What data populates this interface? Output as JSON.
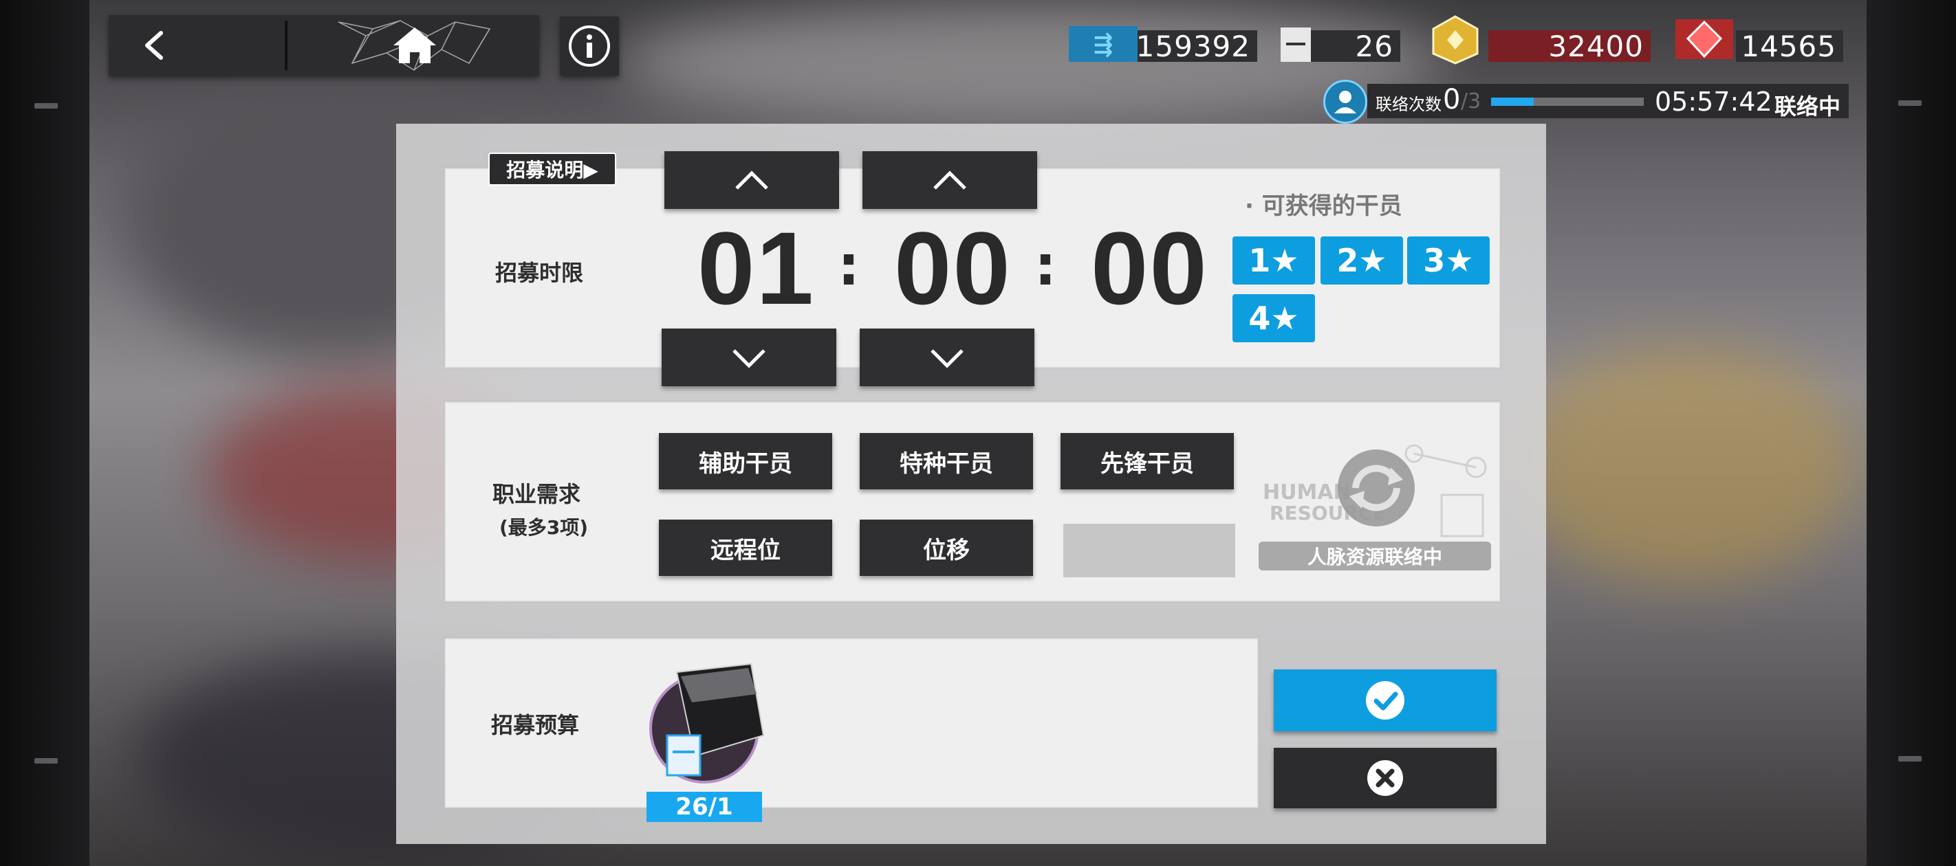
{
  "header": {
    "back_icon": "chevron-left-icon",
    "home_icon": "home-icon",
    "info_icon": "info-icon"
  },
  "resources": {
    "lmd": "159392",
    "permits": "26",
    "gold_hex": "32400",
    "originium": "14565"
  },
  "contact": {
    "label": "联络次数",
    "count": "0",
    "max": "/3",
    "time": "05:57:42",
    "status": "联络中",
    "progress": 0.28
  },
  "recruit": {
    "guide_label": "招募说明▶",
    "time_label": "招募时限",
    "hours": "01",
    "minutes": "00",
    "seconds": "00",
    "colon": ":",
    "obtainable_label": "可获得的干员",
    "stars": [
      "1★",
      "2★",
      "3★",
      "4★"
    ],
    "tags_label": "职业需求",
    "tags_sub": "(最多3项)",
    "tags": [
      "辅助干员",
      "特种干员",
      "先锋干员",
      "远程位",
      "位移"
    ],
    "hr_status": "人脉资源联络中",
    "budget_label": "招募预算",
    "budget_value": "26/1"
  },
  "colors": {
    "accent": "#0d9ee0",
    "dark": "#2f2f31",
    "cancel": "#2c2c2e"
  }
}
